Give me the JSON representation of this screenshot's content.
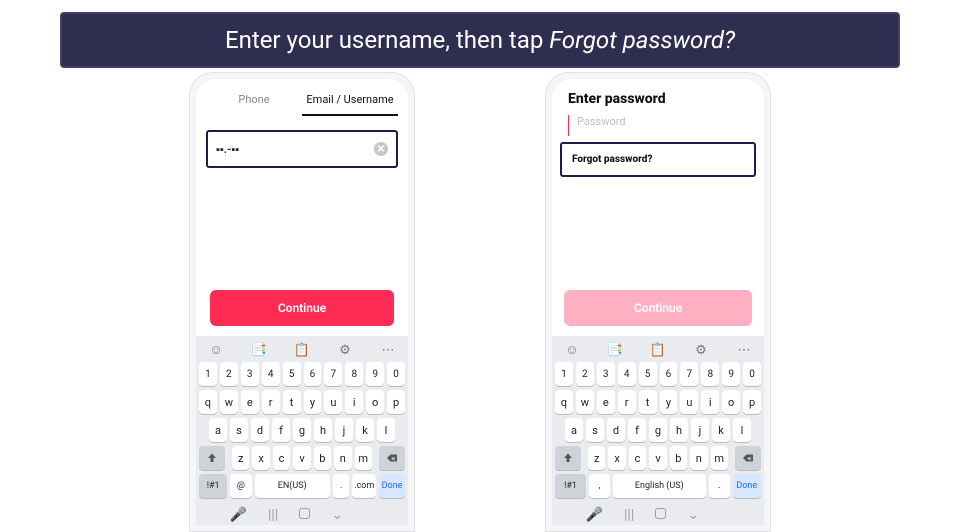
{
  "banner": {
    "prefix": "Enter your username, then tap ",
    "emphasis": "Forgot password?"
  },
  "left": {
    "tabs": {
      "phone": "Phone",
      "email": "Email / Username"
    },
    "input_value": "▪▪.-▪▪",
    "continue_label": "Continue"
  },
  "right": {
    "heading": "Enter password",
    "placeholder": "Password",
    "forgot_label": "Forgot password?",
    "continue_label": "Continue"
  },
  "keyboard": {
    "numbers": [
      "1",
      "2",
      "3",
      "4",
      "5",
      "6",
      "7",
      "8",
      "9",
      "0"
    ],
    "row1": [
      "q",
      "w",
      "e",
      "r",
      "t",
      "y",
      "u",
      "i",
      "o",
      "p"
    ],
    "row2": [
      "a",
      "s",
      "d",
      "f",
      "g",
      "h",
      "j",
      "k",
      "l"
    ],
    "row3": [
      "z",
      "x",
      "c",
      "v",
      "b",
      "n",
      "m"
    ],
    "sym": "!#1",
    "at": "@",
    "comma": ",",
    "lang_left": "EN(US)",
    "lang_right": "English (US)",
    "dot": ".",
    "com": ".com",
    "done": "Done"
  }
}
